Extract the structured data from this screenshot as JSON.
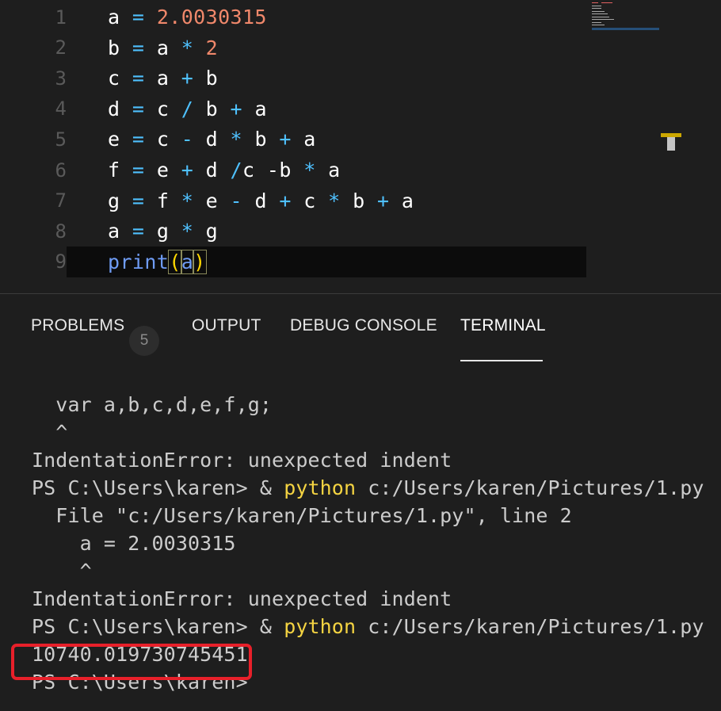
{
  "editor": {
    "lines": [
      {
        "number": "1",
        "tokens": [
          [
            "a",
            "var"
          ],
          [
            " = ",
            "op"
          ],
          [
            "2.0030315",
            "num"
          ]
        ]
      },
      {
        "number": "2",
        "tokens": [
          [
            "b",
            "var"
          ],
          [
            " = ",
            "op"
          ],
          [
            "a",
            "var"
          ],
          [
            " * ",
            "op"
          ],
          [
            "2",
            "num"
          ]
        ]
      },
      {
        "number": "3",
        "tokens": [
          [
            "c",
            "var"
          ],
          [
            " = ",
            "op"
          ],
          [
            "a",
            "var"
          ],
          [
            " + ",
            "op"
          ],
          [
            "b",
            "var"
          ]
        ]
      },
      {
        "number": "4",
        "tokens": [
          [
            "d",
            "var"
          ],
          [
            " = ",
            "op"
          ],
          [
            "c",
            "var"
          ],
          [
            " / ",
            "op"
          ],
          [
            "b",
            "var"
          ],
          [
            " + ",
            "op"
          ],
          [
            "a",
            "var"
          ]
        ]
      },
      {
        "number": "5",
        "tokens": [
          [
            "e",
            "var"
          ],
          [
            " = ",
            "op"
          ],
          [
            "c",
            "var"
          ],
          [
            " - ",
            "op"
          ],
          [
            "d",
            "var"
          ],
          [
            " * ",
            "op"
          ],
          [
            "b",
            "var"
          ],
          [
            " + ",
            "op"
          ],
          [
            "a",
            "var"
          ]
        ]
      },
      {
        "number": "6",
        "tokens": [
          [
            "f",
            "var"
          ],
          [
            " = ",
            "op"
          ],
          [
            "e",
            "var"
          ],
          [
            " + ",
            "op"
          ],
          [
            "d",
            "var"
          ],
          [
            " /",
            "op"
          ],
          [
            "c",
            "var"
          ],
          [
            " -",
            "var"
          ],
          [
            "b",
            "var"
          ],
          [
            " * ",
            "op"
          ],
          [
            "a",
            "var"
          ]
        ]
      },
      {
        "number": "7",
        "tokens": [
          [
            "g",
            "var"
          ],
          [
            " = ",
            "op"
          ],
          [
            "f",
            "var"
          ],
          [
            " * ",
            "op"
          ],
          [
            "e",
            "var"
          ],
          [
            " - ",
            "op"
          ],
          [
            "d",
            "var"
          ],
          [
            " + ",
            "op"
          ],
          [
            "c",
            "var"
          ],
          [
            " * ",
            "op"
          ],
          [
            "b",
            "var"
          ],
          [
            " + ",
            "op"
          ],
          [
            "a",
            "var"
          ]
        ]
      },
      {
        "number": "8",
        "tokens": [
          [
            "a",
            "var"
          ],
          [
            " = ",
            "op"
          ],
          [
            "g",
            "var"
          ],
          [
            " * ",
            "op"
          ],
          [
            "g",
            "var"
          ]
        ]
      },
      {
        "number": "9",
        "tokens": [
          [
            "print",
            "fn"
          ],
          [
            "(",
            "paren"
          ],
          [
            "a",
            "arg"
          ],
          [
            ")",
            "paren"
          ]
        ],
        "current": true
      }
    ]
  },
  "panel": {
    "tabs": [
      {
        "label": "PROBLEMS",
        "badge": "5"
      },
      {
        "label": "OUTPUT"
      },
      {
        "label": "DEBUG CONSOLE"
      },
      {
        "label": "TERMINAL",
        "active": true
      }
    ]
  },
  "terminal": {
    "lines": [
      "  var a,b,c,d,e,f,g;",
      "  ^",
      "IndentationError: unexpected indent",
      "PS C:\\Users\\karen> & |python| c:/Users/karen/Pictures/1.py",
      "  File \"c:/Users/karen/Pictures/1.py\", line 2",
      "    a = 2.0030315",
      "    ^",
      "IndentationError: unexpected indent",
      "PS C:\\Users\\karen> & |python| c:/Users/karen/Pictures/1.py",
      "10740.019730745451",
      "PS C:\\Users\\karen>"
    ]
  },
  "colors": {
    "highlight_box": "#e8202a",
    "python_keyword": "#f5d442",
    "number_literal": "#f0886b",
    "operator": "#4fc1ff"
  }
}
